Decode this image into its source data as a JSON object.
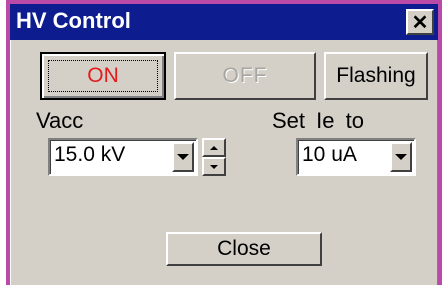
{
  "window": {
    "title": "HV Control",
    "close_glyph": "✕"
  },
  "buttons": {
    "on_label": "ON",
    "off_label": "OFF",
    "flashing_label": "Flashing",
    "close_label": "Close"
  },
  "vacc": {
    "label": "Vacc",
    "value": "15.0 kV"
  },
  "emission": {
    "label": "Set Ie to",
    "value": "10 uA"
  },
  "colors": {
    "titlebar": "#0d1c8e",
    "window_frame": "#b94aa7",
    "face": "#d4d0c8",
    "on_text": "#e31d1d"
  },
  "icons": [
    "close-icon",
    "dropdown-arrow-icon",
    "spin-up-icon",
    "spin-down-icon"
  ]
}
